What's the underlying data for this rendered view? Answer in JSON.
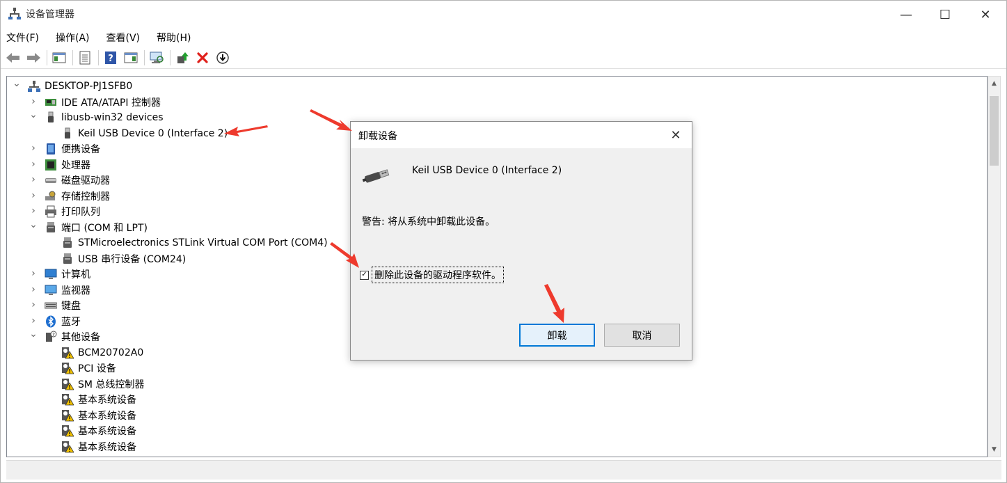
{
  "window": {
    "title": "设备管理器",
    "controls": {
      "minimize": "—",
      "maximize": "☐",
      "close": "✕"
    }
  },
  "menu": [
    {
      "label": "文件(F)"
    },
    {
      "label": "操作(A)"
    },
    {
      "label": "查看(V)"
    },
    {
      "label": "帮助(H)"
    }
  ],
  "toolbar": {
    "buttons": [
      "back-icon",
      "forward-icon",
      "properties-pane-icon",
      "list-icon",
      "help-icon",
      "action-pane-icon",
      "scan-hardware-icon",
      "update-driver-icon",
      "uninstall-icon",
      "disable-icon"
    ]
  },
  "tree": {
    "root": "DESKTOP-PJ1SFB0",
    "nodes": [
      {
        "label": "IDE ATA/ATAPI 控制器",
        "level": 1,
        "expanded": false,
        "icon": "ide-controller-icon"
      },
      {
        "label": "libusb-win32 devices",
        "level": 1,
        "expanded": true,
        "icon": "usb-plug-icon"
      },
      {
        "label": "Keil USB Device 0 (Interface 2)",
        "level": 2,
        "expanded": null,
        "icon": "usb-plug-icon"
      },
      {
        "label": "便携设备",
        "level": 1,
        "expanded": false,
        "icon": "portable-device-icon"
      },
      {
        "label": "处理器",
        "level": 1,
        "expanded": false,
        "icon": "processor-icon"
      },
      {
        "label": "磁盘驱动器",
        "level": 1,
        "expanded": false,
        "icon": "disk-drive-icon"
      },
      {
        "label": "存储控制器",
        "level": 1,
        "expanded": false,
        "icon": "storage-controller-icon"
      },
      {
        "label": "打印队列",
        "level": 1,
        "expanded": false,
        "icon": "printer-icon"
      },
      {
        "label": "端口 (COM 和 LPT)",
        "level": 1,
        "expanded": true,
        "icon": "port-icon"
      },
      {
        "label": "STMicroelectronics STLink Virtual COM Port (COM4)",
        "level": 2,
        "expanded": null,
        "icon": "port-icon"
      },
      {
        "label": "USB 串行设备 (COM24)",
        "level": 2,
        "expanded": null,
        "icon": "port-icon"
      },
      {
        "label": "计算机",
        "level": 1,
        "expanded": false,
        "icon": "computer-icon"
      },
      {
        "label": "监视器",
        "level": 1,
        "expanded": false,
        "icon": "monitor-icon"
      },
      {
        "label": "键盘",
        "level": 1,
        "expanded": false,
        "icon": "keyboard-icon"
      },
      {
        "label": "蓝牙",
        "level": 1,
        "expanded": false,
        "icon": "bluetooth-icon"
      },
      {
        "label": "其他设备",
        "level": 1,
        "expanded": true,
        "icon": "unknown-device-icon"
      },
      {
        "label": "BCM20702A0",
        "level": 2,
        "expanded": null,
        "icon": "warning-device-icon"
      },
      {
        "label": "PCI 设备",
        "level": 2,
        "expanded": null,
        "icon": "warning-device-icon"
      },
      {
        "label": "SM 总线控制器",
        "level": 2,
        "expanded": null,
        "icon": "warning-device-icon"
      },
      {
        "label": "基本系统设备",
        "level": 2,
        "expanded": null,
        "icon": "warning-device-icon"
      },
      {
        "label": "基本系统设备",
        "level": 2,
        "expanded": null,
        "icon": "warning-device-icon"
      },
      {
        "label": "基本系统设备",
        "level": 2,
        "expanded": null,
        "icon": "warning-device-icon"
      },
      {
        "label": "基本系统设备",
        "level": 2,
        "expanded": null,
        "icon": "warning-device-icon"
      }
    ]
  },
  "dialog": {
    "title": "卸载设备",
    "device_name": "Keil USB Device 0 (Interface 2)",
    "warning": "警告: 将从系统中卸载此设备。",
    "checkbox_label": "删除此设备的驱动程序软件。",
    "checkbox_checked": true,
    "uninstall_button": "卸载",
    "cancel_button": "取消"
  },
  "colors": {
    "accent": "#0078d7",
    "annotation_arrow": "#ee3a2d",
    "warning_yellow": "#f5c400"
  }
}
